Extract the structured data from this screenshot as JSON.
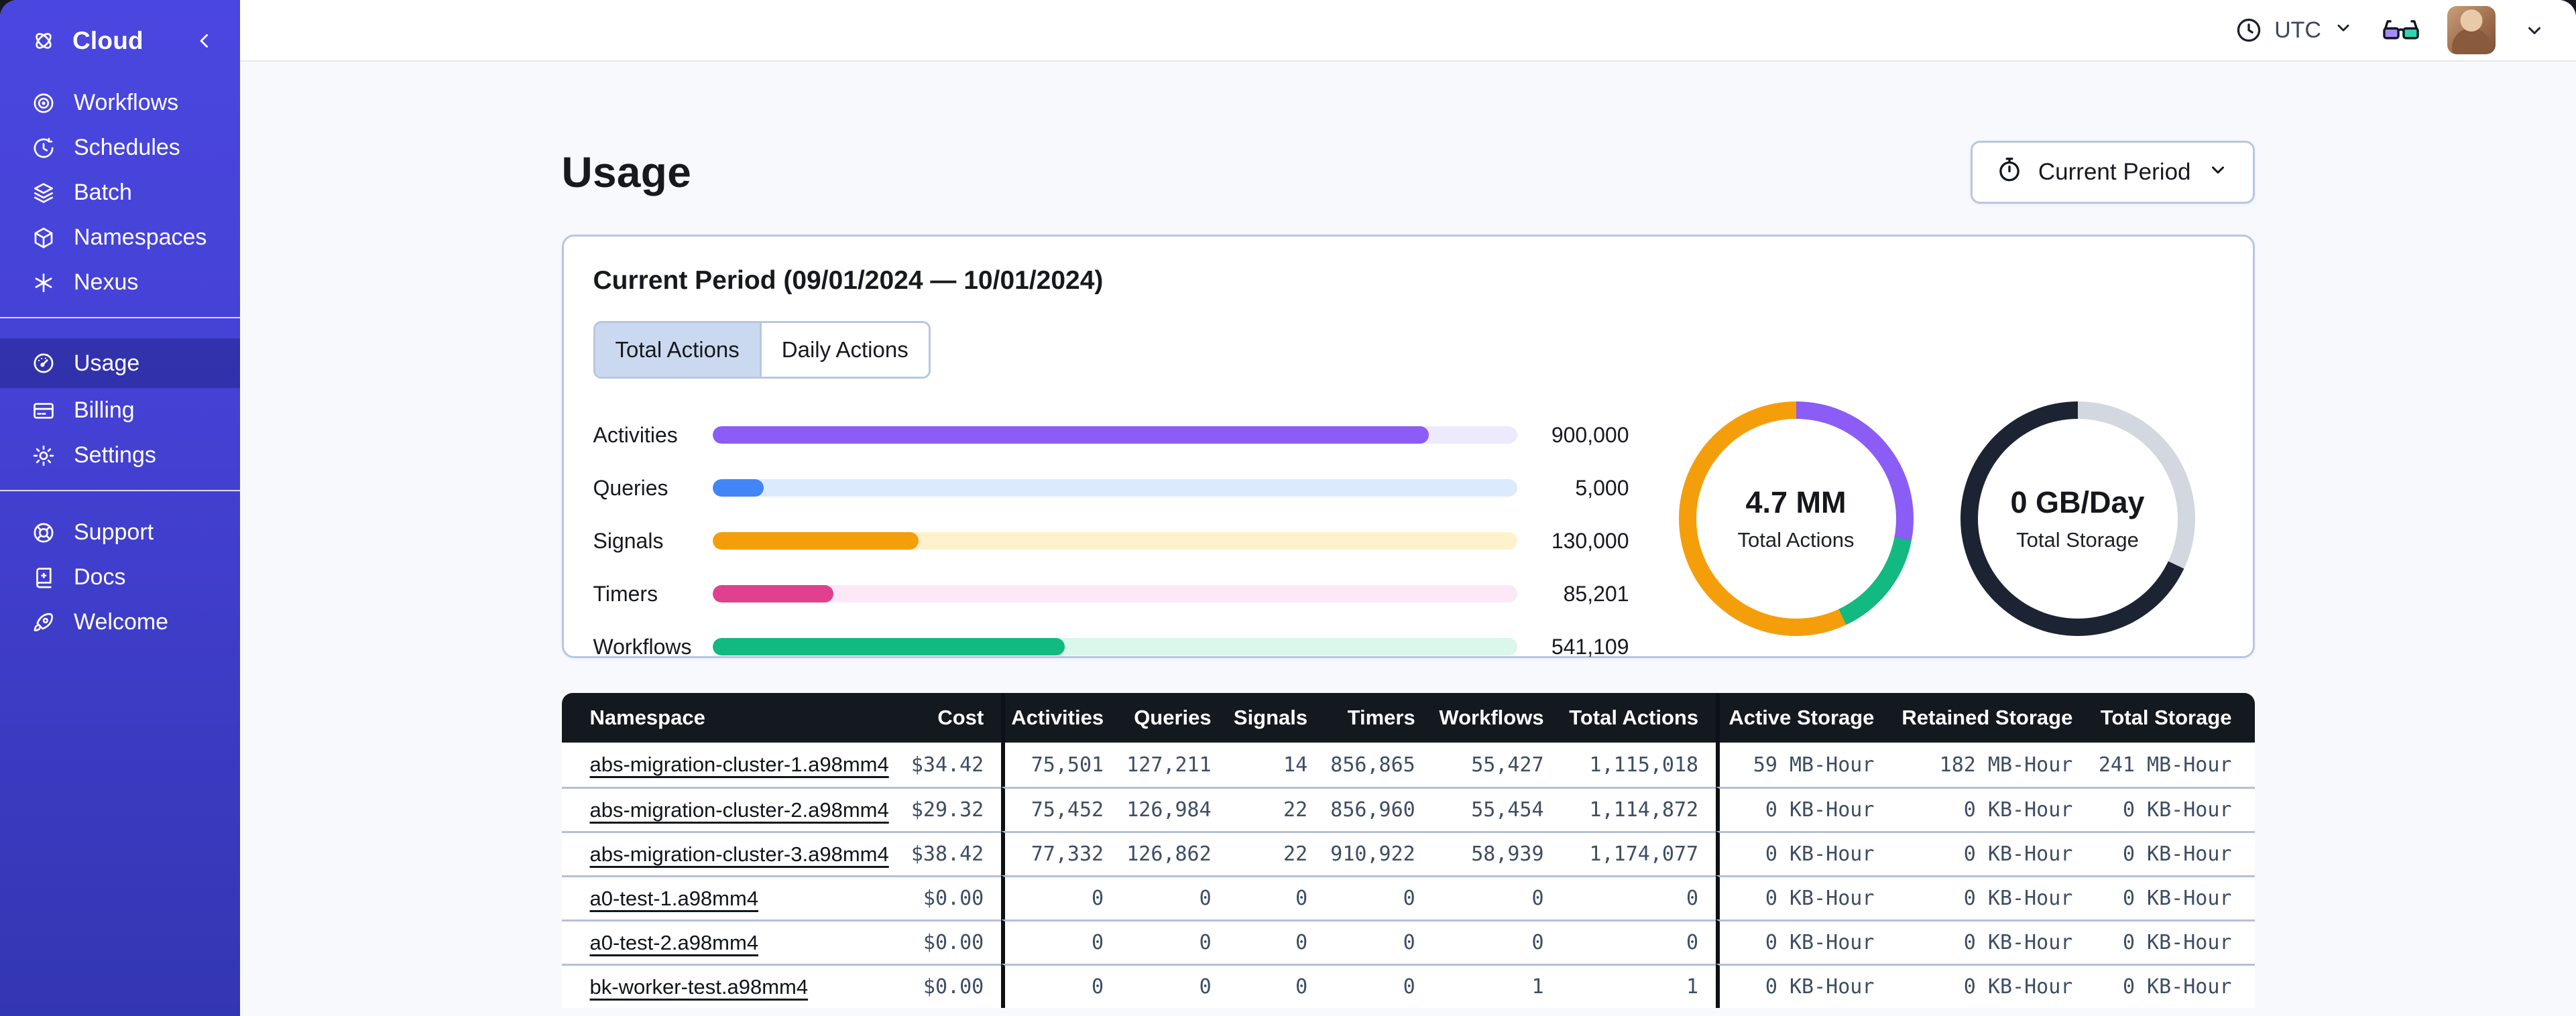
{
  "sidebar": {
    "brand_label": "Cloud",
    "main": [
      {
        "label": "Workflows"
      },
      {
        "label": "Schedules"
      },
      {
        "label": "Batch"
      },
      {
        "label": "Namespaces"
      },
      {
        "label": "Nexus"
      }
    ],
    "account": [
      {
        "label": "Usage",
        "active": true
      },
      {
        "label": "Billing",
        "active": false
      },
      {
        "label": "Settings",
        "active": false
      }
    ],
    "help": [
      {
        "label": "Support"
      },
      {
        "label": "Docs"
      },
      {
        "label": "Welcome"
      }
    ]
  },
  "topbar": {
    "timezone_label": "UTC"
  },
  "page": {
    "title": "Usage",
    "period_selector_label": "Current Period"
  },
  "usage_card": {
    "heading": "Current Period (09/01/2024 — 10/01/2024)",
    "tabs": [
      {
        "label": "Total Actions",
        "active": true
      },
      {
        "label": "Daily Actions",
        "active": false
      }
    ]
  },
  "chart_data": [
    {
      "type": "bar",
      "title": "Actions by type (current period)",
      "categories": [
        "Activities",
        "Queries",
        "Signals",
        "Timers",
        "Workflows"
      ],
      "values": [
        900000,
        5000,
        130000,
        85201,
        541109
      ],
      "value_labels": [
        "900,000",
        "5,000",
        "130,000",
        "85,201",
        "541,109"
      ],
      "fill_pct": [
        89,
        6.4,
        25.6,
        15,
        43.8
      ],
      "fill_widths": [
        "89%",
        "6.4%",
        "25.6%",
        "15%",
        "43.8%"
      ],
      "colors": [
        "#8b5cf6",
        "#4285f4",
        "#f59e0b",
        "#e0418f",
        "#12b981"
      ],
      "track_colors": [
        "#ede9fe",
        "#dbeafe",
        "#fdf2cc",
        "#fce8f6",
        "#d9f7ea"
      ],
      "legend_position": "none",
      "grid": false
    },
    {
      "type": "donut",
      "center_value": "4.7 MM",
      "center_label": "Total Actions",
      "segments": [
        {
          "label": "activities",
          "color": "#8b5cf6",
          "pct": 28
        },
        {
          "label": "workflows",
          "color": "#12b981",
          "pct": 15
        },
        {
          "label": "signals",
          "color": "#f59e0b",
          "pct": 57
        }
      ]
    },
    {
      "type": "donut",
      "center_value": "0 GB/Day",
      "center_label": "Total Storage",
      "segments": [
        {
          "label": "remaining",
          "color": "#d3d7df",
          "pct": 32
        },
        {
          "label": "used",
          "color": "#1c2433",
          "pct": 68
        }
      ]
    }
  ],
  "table": {
    "headers": [
      "Namespace",
      "Cost",
      "Activities",
      "Queries",
      "Signals",
      "Timers",
      "Workflows",
      "Total Actions",
      "Active Storage",
      "Retained Storage",
      "Total Storage"
    ],
    "rows": [
      [
        "abs-migration-cluster-1.a98mm4",
        "$34.42",
        "75,501",
        "127,211",
        "14",
        "856,865",
        "55,427",
        "1,115,018",
        "59 MB-Hour",
        "182 MB-Hour",
        "241 MB-Hour"
      ],
      [
        "abs-migration-cluster-2.a98mm4",
        "$29.32",
        "75,452",
        "126,984",
        "22",
        "856,960",
        "55,454",
        "1,114,872",
        "0 KB-Hour",
        "0 KB-Hour",
        "0 KB-Hour"
      ],
      [
        "abs-migration-cluster-3.a98mm4",
        "$38.42",
        "77,332",
        "126,862",
        "22",
        "910,922",
        "58,939",
        "1,174,077",
        "0 KB-Hour",
        "0 KB-Hour",
        "0 KB-Hour"
      ],
      [
        "a0-test-1.a98mm4",
        "$0.00",
        "0",
        "0",
        "0",
        "0",
        "0",
        "0",
        "0 KB-Hour",
        "0 KB-Hour",
        "0 KB-Hour"
      ],
      [
        "a0-test-2.a98mm4",
        "$0.00",
        "0",
        "0",
        "0",
        "0",
        "0",
        "0",
        "0 KB-Hour",
        "0 KB-Hour",
        "0 KB-Hour"
      ],
      [
        "bk-worker-test.a98mm4",
        "$0.00",
        "0",
        "0",
        "0",
        "0",
        "1",
        "1",
        "0 KB-Hour",
        "0 KB-Hour",
        "0 KB-Hour"
      ]
    ]
  }
}
